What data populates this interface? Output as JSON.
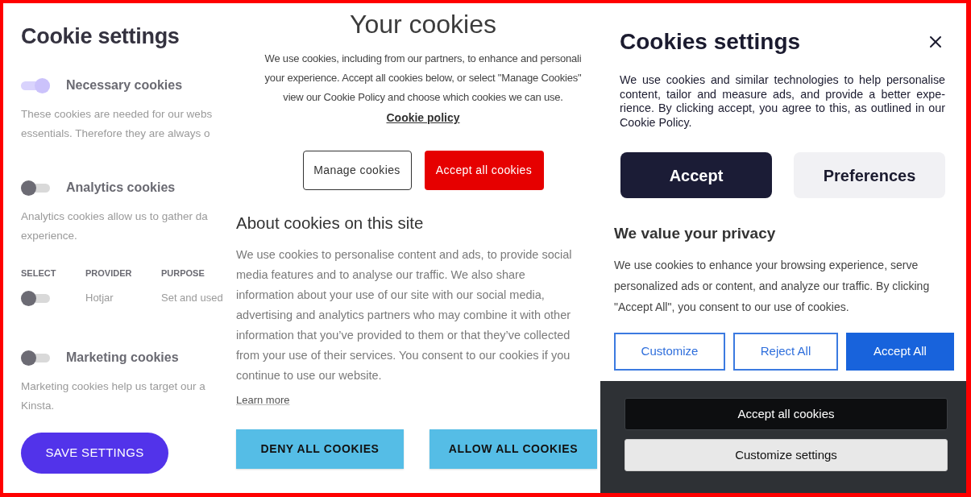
{
  "cookie_settings_panel": {
    "title": "Cookie settings",
    "categories": [
      {
        "name": "Necessary cookies",
        "on": true,
        "description": "These cookies are needed for our webs\nessentials. Therefore they are always o"
      },
      {
        "name": "Analytics cookies",
        "on": false,
        "description": "Analytics cookies allow us to gather da\nexperience.",
        "table": {
          "columns": [
            "SELECT",
            "PROVIDER",
            "PURPOSE"
          ],
          "rows": [
            {
              "on": false,
              "provider": "Hotjar",
              "purpose": "Set and used"
            }
          ]
        }
      },
      {
        "name": "Marketing cookies",
        "on": false,
        "description": "Marketing cookies help us target our a\nKinsta."
      }
    ],
    "save_button": "SAVE SETTINGS"
  },
  "your_cookies_banner": {
    "title": "Your cookies",
    "text": "We use cookies, including from our partners, to enhance and personali\nyour experience. Accept all cookies below, or select \"Manage Cookies\"\nview our Cookie Policy and choose which cookies we can use.",
    "link": "Cookie policy",
    "buttons": [
      {
        "label": "Manage cookies",
        "kind": "outline"
      },
      {
        "label": "Accept all cookies",
        "kind": "primary"
      }
    ]
  },
  "about_cookies_banner": {
    "title": "About cookies on this site",
    "text": "We use cookies to personalise content and ads, to provide social media features and to analyse our traffic. We also share information about your use of our site with our social media, advertising and analytics partners who may combine it with other information that you’ve provided to them or that they’ve collected from your use of their services. You consent to our cookies if you continue to use our website.",
    "link": "Learn more",
    "buttons": [
      {
        "label": "DENY ALL COOKIES"
      },
      {
        "label": "ALLOW ALL COOKIES"
      }
    ]
  },
  "cookies_settings_dialog": {
    "title": "Cookies settings",
    "text": "We use cookies and similar technologies to help personalise content, tailor and measure ads, and provide a better expe-rience. By clicking accept, you agree to this, as outlined in our Cookie Policy.",
    "buttons": [
      {
        "label": "Accept",
        "kind": "primary"
      },
      {
        "label": "Preferences",
        "kind": "secondary"
      }
    ]
  },
  "privacy_banner": {
    "title": "We value your privacy",
    "text": "We use cookies to enhance your browsing experience, serve personalized ads or content, and analyze our traffic. By clicking \"Accept All\", you consent to our use of cookies.",
    "buttons": [
      {
        "label": "Customize",
        "kind": "outline"
      },
      {
        "label": "Reject All",
        "kind": "outline"
      },
      {
        "label": "Accept All",
        "kind": "primary"
      }
    ]
  },
  "cookie_bar": {
    "buttons": [
      {
        "label": "Accept all cookies",
        "kind": "primary"
      },
      {
        "label": "Customize settings",
        "kind": "secondary"
      }
    ]
  }
}
